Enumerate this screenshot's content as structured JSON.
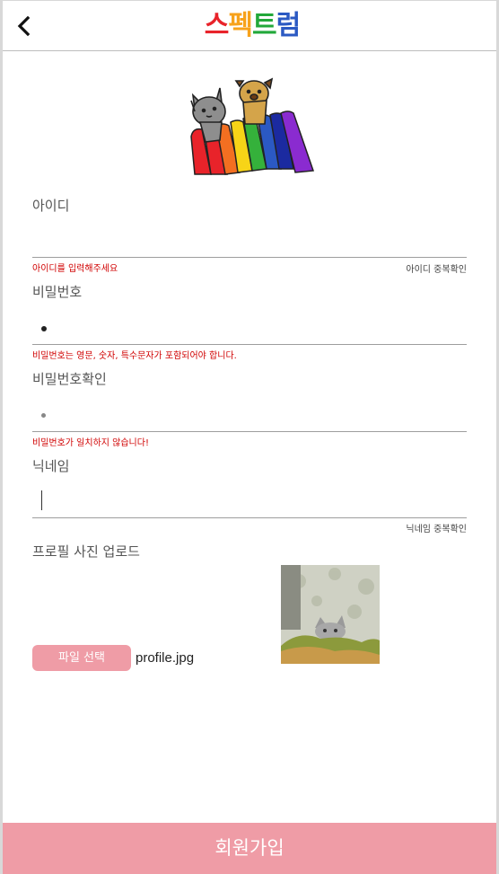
{
  "header": {
    "logo_chars": [
      {
        "char": "스",
        "color": "#e8232a"
      },
      {
        "char": "펙",
        "color": "#f7a21b"
      },
      {
        "char": "트",
        "color": "#22a83a"
      },
      {
        "char": "럼",
        "color": "#2b59c3"
      }
    ]
  },
  "form": {
    "id_label": "아이디",
    "id_error": "아이디를 입력해주세요",
    "id_check": "아이디 중복확인",
    "password_label": "비밀번호",
    "password_error": "비밀번호는 영문, 숫자, 특수문자가 포함되어야 합니다.",
    "password_confirm_label": "비밀번호확인",
    "password_confirm_error": "비밀번호가 일치하지 않습니다!",
    "nickname_label": "닉네임",
    "nickname_check": "닉네임 중복확인",
    "profile_label": "프로필 사진 업로드",
    "file_button": "파일 선택",
    "file_name": "profile.jpg"
  },
  "submit_label": "회원가입",
  "colors": {
    "accent": "#ef9ca6",
    "error": "#d00000"
  }
}
